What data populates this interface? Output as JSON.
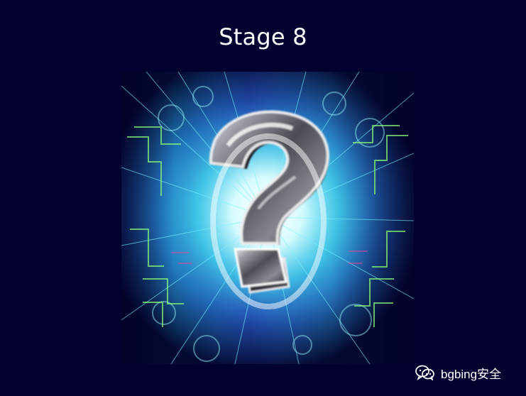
{
  "stage": {
    "title": "Stage 8"
  },
  "watermark": {
    "text": "bgbing安全",
    "icon": "wechat-icon"
  },
  "illustration": {
    "subject": "question-mark-icon"
  },
  "colors": {
    "background": "#02002f",
    "title": "#ffffff",
    "accent_cyan": "#41bce5",
    "accent_blue": "#2a4eb8",
    "accent_green": "#8cff72",
    "question_mark": "#7b7b80"
  }
}
